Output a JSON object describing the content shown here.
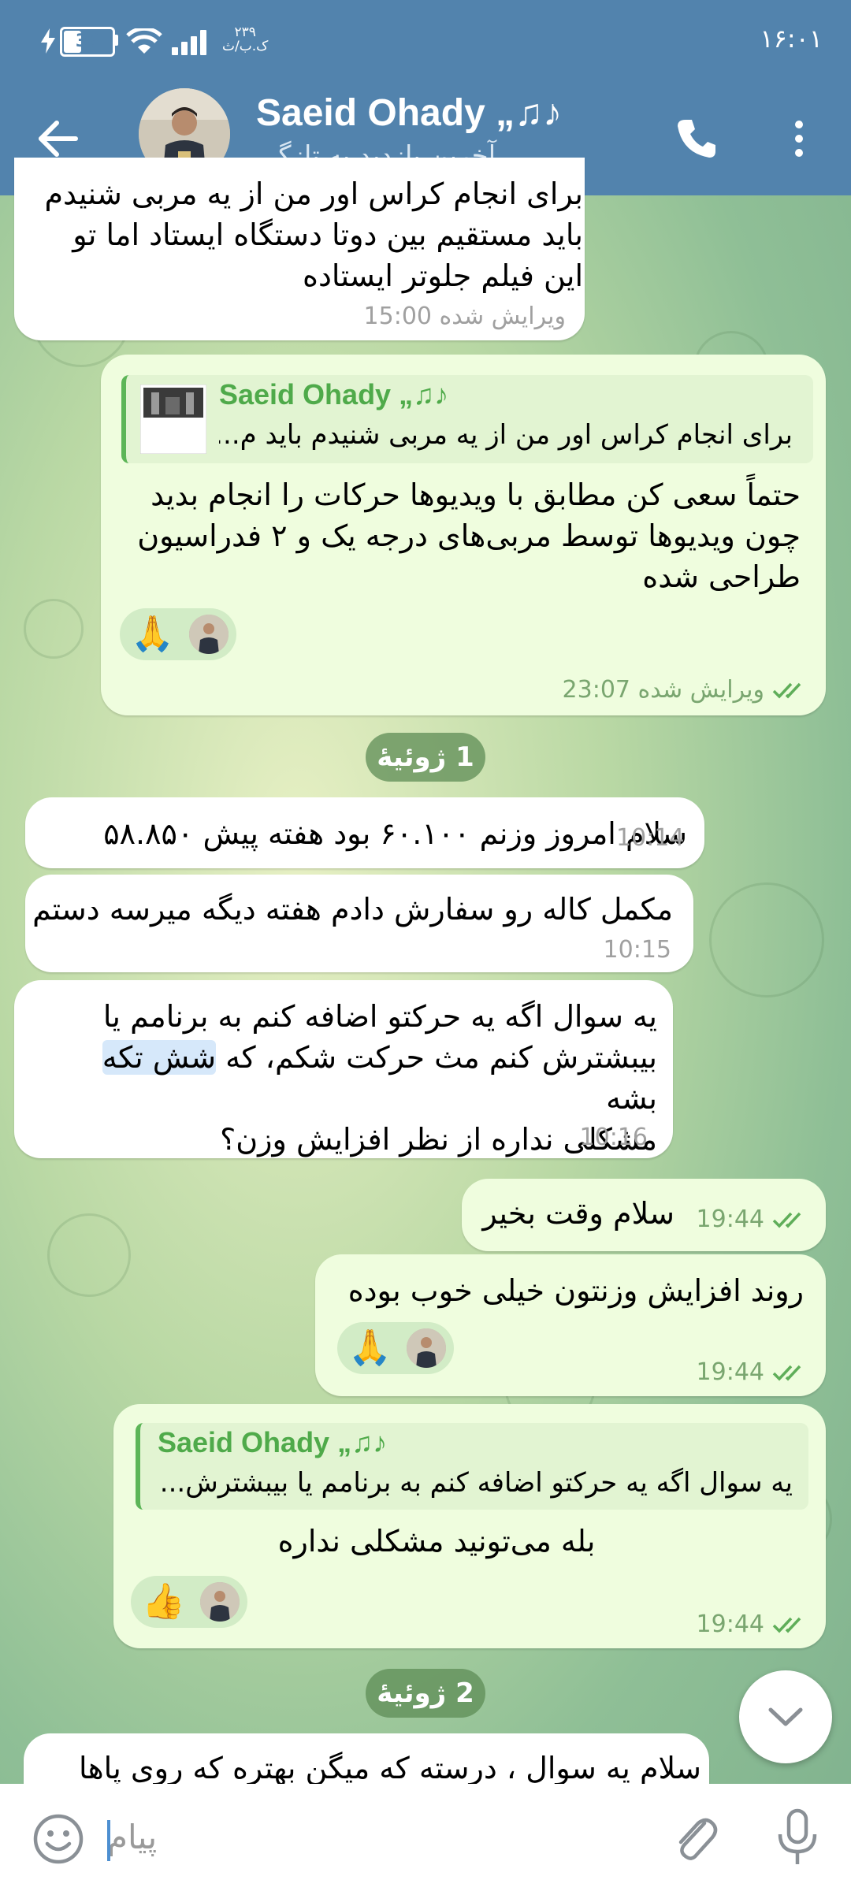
{
  "status_bar": {
    "battery": "38",
    "net_speed_value": "۲۳۹",
    "net_speed_unit": "ک.ب/ث",
    "time": "۱۶:۰۱"
  },
  "header": {
    "name": "Saeid Ohady „♫♪",
    "status": "آخرین بازدید به تازگی"
  },
  "messages": [
    {
      "text": "برای انجام کراس اور من از یه مربی شنیدم\nباید مستقیم بین دوتا دستگاه ایستاد اما تو\nاین فیلم جلوتر ایستاده",
      "time": "ویرایش شده 15:00"
    },
    {
      "reply_name": "Saeid Ohady „♫♪",
      "reply_text": "برای انجام کراس اور من از یه مربی شنیدم باید م...",
      "text": "حتماً سعی کن مطابق با ویدیوها حرکات را انجام بدید\nچون ویدیوها توسط مربی‌های درجه یک و ۲ فدراسیون\nطراحی شده",
      "reaction": "🙏",
      "time": "ویرایش شده 23:07"
    },
    {
      "text": "سلام امروز وزنم ۶۰.۱۰۰ بود هفته پیش ۵۸.۸۵۰",
      "time": "10:14"
    },
    {
      "text": "مکمل کاله رو سفارش دادم هفته دیگه میرسه دستم",
      "time": "10:15"
    },
    {
      "text_before": "یه سوال اگه یه حرکتو اضافه کنم به برنامم یا\nبیبشترش کنم مث حرکت شکم، که ",
      "text_highlight": "شش تکه",
      "text_after": " بشه\nمشکلی نداره از نظر افزایش وزن؟",
      "time": "10:16"
    },
    {
      "text": "سلام وقت بخیر",
      "time": "19:44"
    },
    {
      "text": "روند افزایش وزنتون خیلی خوب بوده",
      "reaction": "🙏",
      "time": "19:44"
    },
    {
      "reply_name": "Saeid Ohady „♫♪",
      "reply_text": "یه سوال اگه یه حرکتو اضافه کنم به برنامم یا بیبشترش...",
      "text": "بله می‌تونید مشکلی نداره",
      "reaction": "👍",
      "time": "19:44"
    },
    {
      "text": "سلام یه سوال ، درسته که میگن بهتره که روی پاها"
    }
  ],
  "dates": {
    "first": "1 ژوئیهٔ",
    "second": "2 ژوئیهٔ"
  },
  "composer": {
    "placeholder": "پیام"
  },
  "colors": {
    "header": "#5283ad",
    "outgoing_bubble": "#effdde",
    "incoming_bubble": "#ffffff",
    "accent_green": "#4faa4a"
  },
  "icons": [
    "back-arrow-icon",
    "phone-icon",
    "more-vert-icon",
    "emoji-icon",
    "attach-icon",
    "mic-icon",
    "chevron-down-icon",
    "double-check-icon"
  ]
}
